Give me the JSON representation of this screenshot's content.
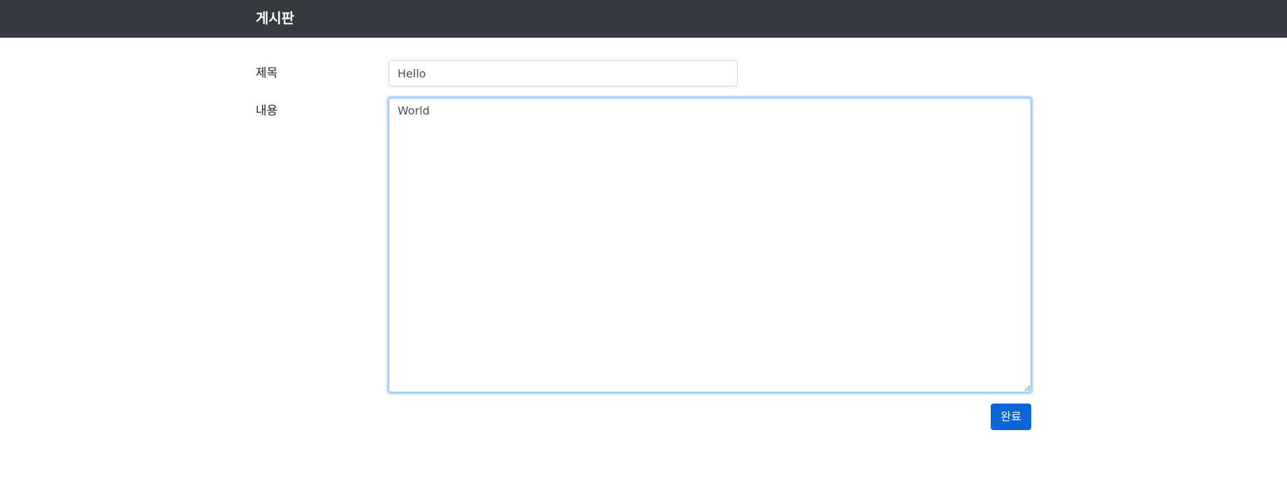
{
  "navbar": {
    "brand": "게시판",
    "background_color": "#343a40"
  },
  "form": {
    "title_label": "제목",
    "title_value": "Hello",
    "content_label": "내용",
    "content_value": "World",
    "submit_label": "완료",
    "accent_color": "#0a66d6"
  }
}
